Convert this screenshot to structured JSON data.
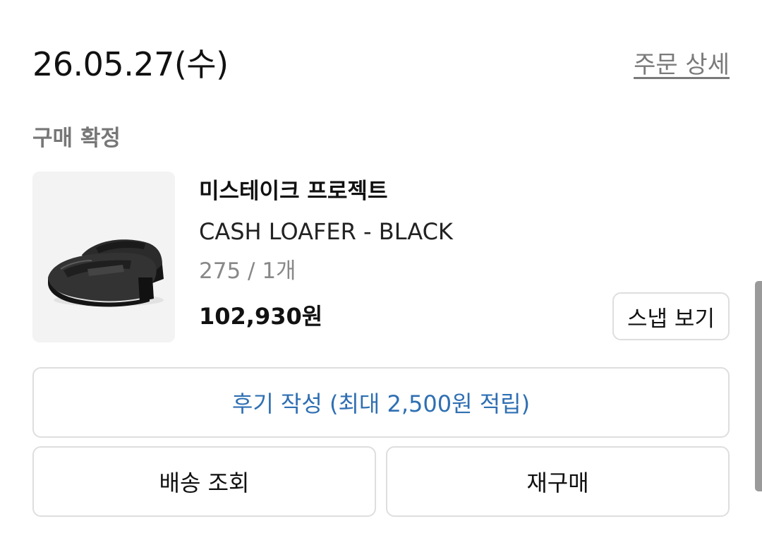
{
  "order": {
    "date": "26.05.27(수)",
    "detail_link": "주문 상세",
    "status": "구매 확정"
  },
  "product": {
    "image_icon": "loafer-shoe-image",
    "brand": "미스테이크 프로젝트",
    "name": "CASH LOAFER - BLACK",
    "option": "275 / 1개",
    "price": "102,930원",
    "snap_button": "스냅 보기"
  },
  "actions": {
    "review_button": "후기 작성 (최대 2,500원 적립)",
    "delivery_button": "배송 조회",
    "rebuy_button": "재구매"
  },
  "colors": {
    "review_accent": "#2f6fb3",
    "border": "#dedede",
    "muted_text": "#777777"
  }
}
